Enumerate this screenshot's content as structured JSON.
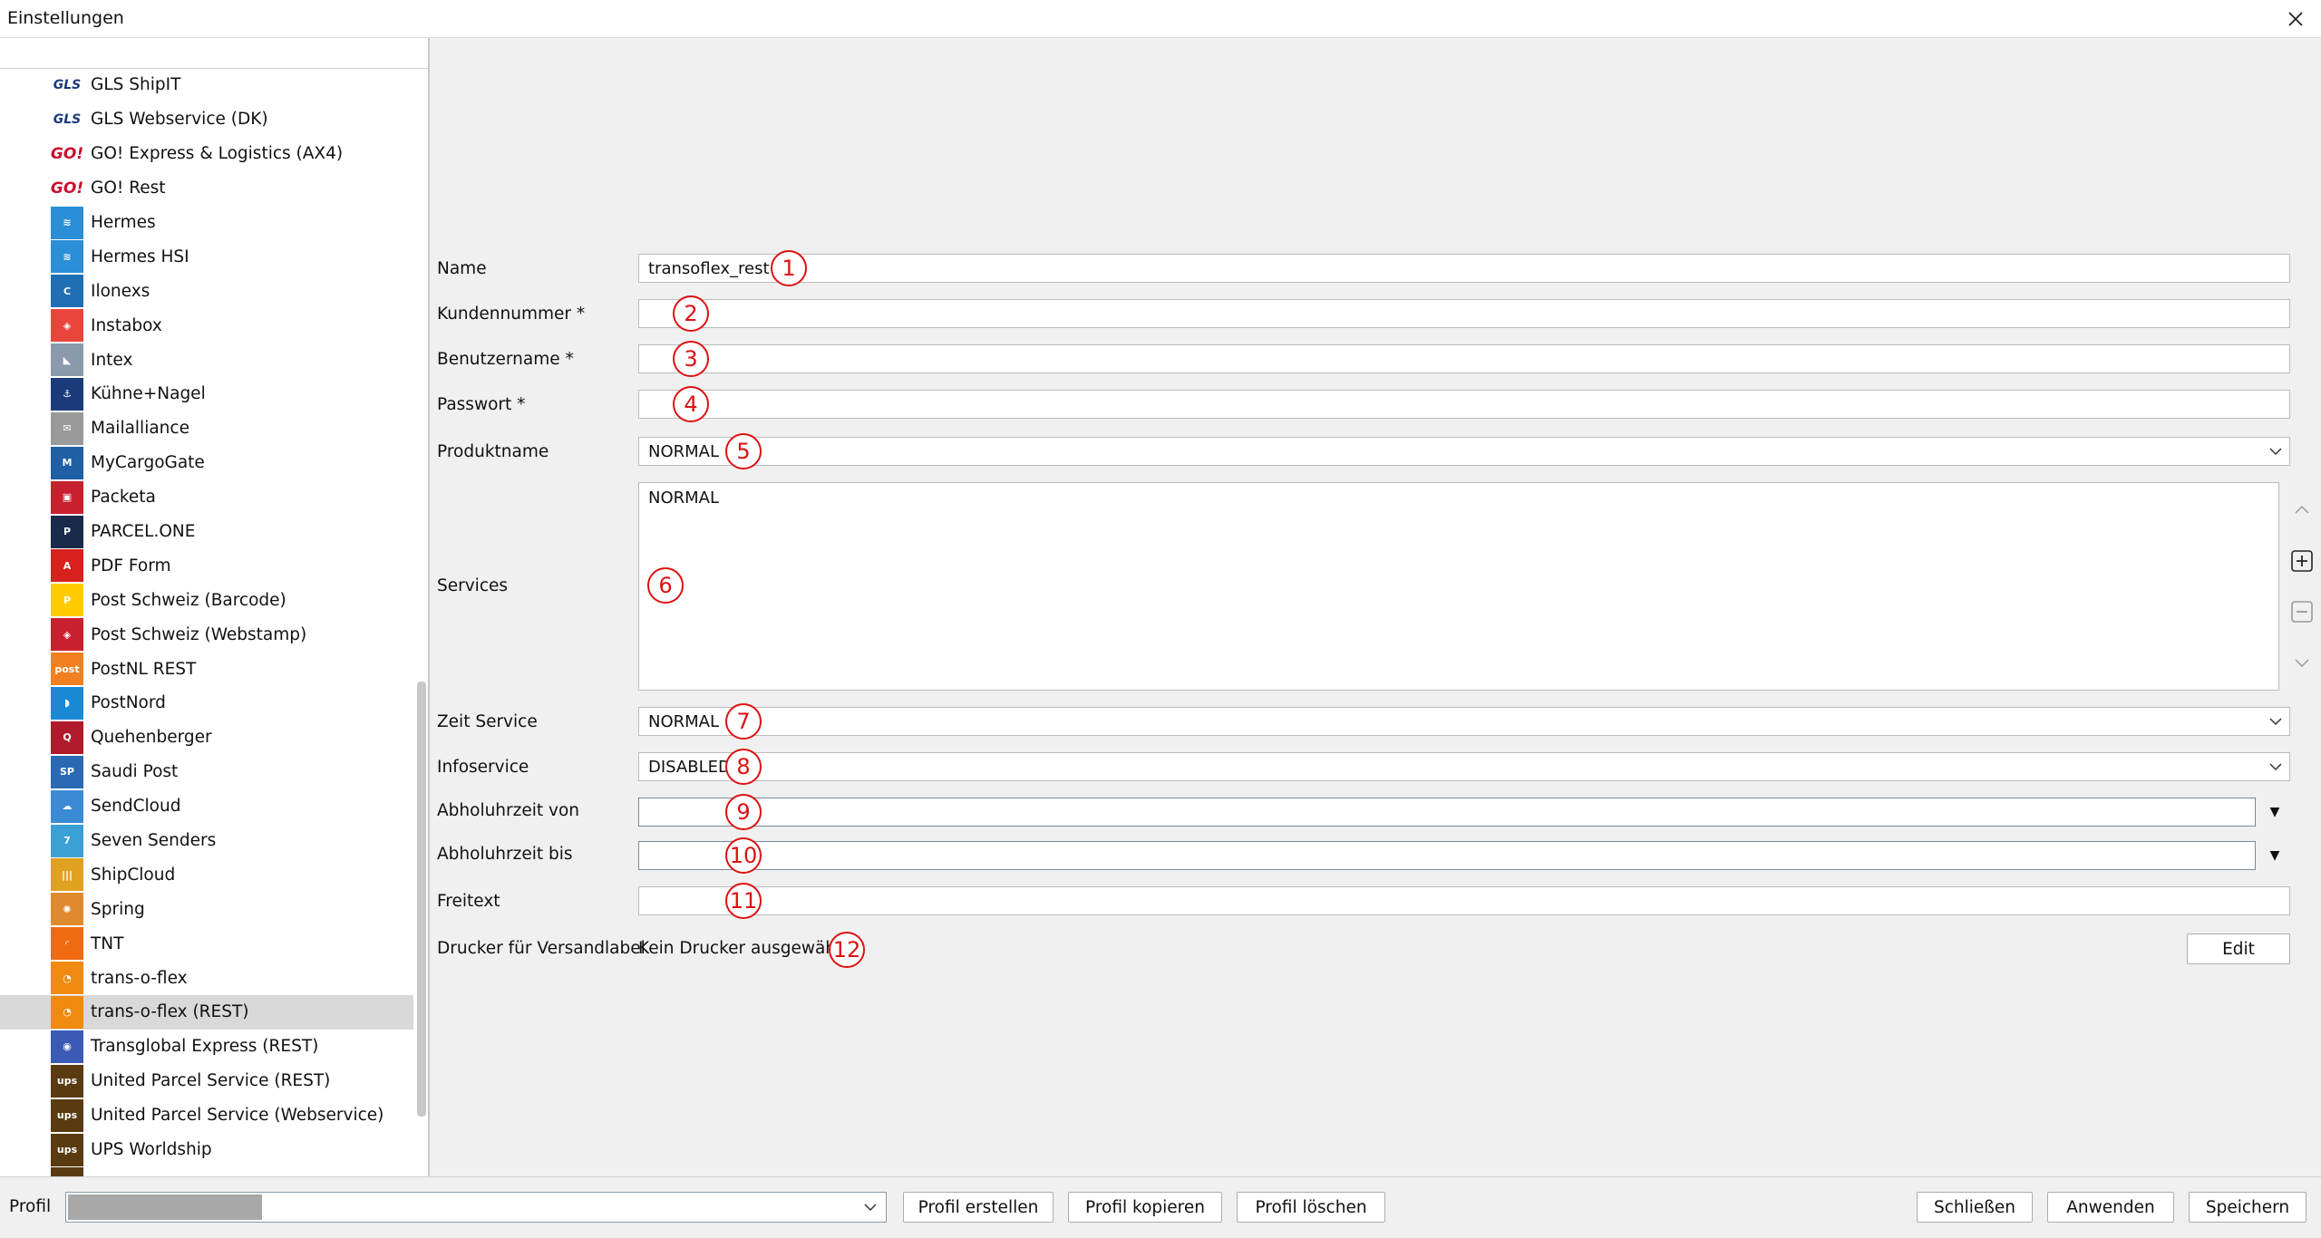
{
  "window": {
    "title": "Einstellungen"
  },
  "sidebar": {
    "items": [
      {
        "label": "GLS ShipIT",
        "icon": "gls-logo-icon",
        "icon_text": "GLS",
        "icon_style": "txt",
        "color": "#1a3a7a"
      },
      {
        "label": "GLS Webservice (DK)",
        "icon": "gls-logo-icon",
        "icon_text": "GLS",
        "icon_style": "txt",
        "color": "#1a3a7a"
      },
      {
        "label": "GO! Express & Logistics (AX4)",
        "icon": "go-logo-icon",
        "icon_text": "GO!",
        "icon_style": "go",
        "color": "#c8102e"
      },
      {
        "label": "GO! Rest",
        "icon": "go-logo-icon",
        "icon_text": "GO!",
        "icon_style": "go",
        "color": "#c8102e"
      },
      {
        "label": "Hermes",
        "icon": "hermes-logo-icon",
        "icon_text": "≋",
        "color": "#2a8fd6"
      },
      {
        "label": "Hermes HSI",
        "icon": "hermes-logo-icon",
        "icon_text": "≋",
        "color": "#2a8fd6"
      },
      {
        "label": "Ilonexs",
        "icon": "ilonexs-logo-icon",
        "icon_text": "C",
        "color": "#1f6fb5"
      },
      {
        "label": "Instabox",
        "icon": "instabox-logo-icon",
        "icon_text": "◈",
        "color": "#e8453c"
      },
      {
        "label": "Intex",
        "icon": "intex-logo-icon",
        "icon_text": "◣",
        "color": "#8a9aaa"
      },
      {
        "label": "Kühne+Nagel",
        "icon": "kuehne-nagel-logo-icon",
        "icon_text": "⚓",
        "color": "#1a3a7a"
      },
      {
        "label": "Mailalliance",
        "icon": "envelope-icon",
        "icon_text": "✉",
        "color": "#9a9a9a"
      },
      {
        "label": "MyCargoGate",
        "icon": "mycargogate-logo-icon",
        "icon_text": "M",
        "color": "#1f5fa5"
      },
      {
        "label": "Packeta",
        "icon": "packeta-logo-icon",
        "icon_text": "▣",
        "color": "#c8202e"
      },
      {
        "label": "PARCEL.ONE",
        "icon": "parcel-one-logo-icon",
        "icon_text": "P",
        "color": "#1a2a4a"
      },
      {
        "label": "PDF Form",
        "icon": "pdf-icon",
        "icon_text": "A",
        "color": "#d8201e"
      },
      {
        "label": "Post Schweiz (Barcode)",
        "icon": "post-schweiz-logo-icon",
        "icon_text": "P",
        "color": "#ffcc00"
      },
      {
        "label": "Post Schweiz (Webstamp)",
        "icon": "post-schweiz-webstamp-icon",
        "icon_text": "◈",
        "color": "#c8202e"
      },
      {
        "label": "PostNL REST",
        "icon": "postnl-logo-icon",
        "icon_text": "post",
        "color": "#f08020"
      },
      {
        "label": "PostNord",
        "icon": "postnord-logo-icon",
        "icon_text": "◗",
        "color": "#1a8ad6"
      },
      {
        "label": "Quehenberger",
        "icon": "quehenberger-logo-icon",
        "icon_text": "Q",
        "color": "#b01a2a"
      },
      {
        "label": "Saudi Post",
        "icon": "saudi-post-logo-icon",
        "icon_text": "SP",
        "color": "#2a6ab5"
      },
      {
        "label": "SendCloud",
        "icon": "sendcloud-logo-icon",
        "icon_text": "☁",
        "color": "#3a8ad6"
      },
      {
        "label": "Seven Senders",
        "icon": "seven-senders-logo-icon",
        "icon_text": "7",
        "color": "#3aa0d6"
      },
      {
        "label": "ShipCloud",
        "icon": "shipcloud-logo-icon",
        "icon_text": "|||",
        "color": "#e0a020"
      },
      {
        "label": "Spring",
        "icon": "spring-logo-icon",
        "icon_text": "✺",
        "color": "#e08a30"
      },
      {
        "label": "TNT",
        "icon": "tnt-logo-icon",
        "icon_text": "◜",
        "color": "#f06a10"
      },
      {
        "label": "trans-o-flex",
        "icon": "trans-o-flex-logo-icon",
        "icon_text": "◔",
        "color": "#f08a10"
      },
      {
        "label": "trans-o-flex (REST)",
        "icon": "trans-o-flex-logo-icon",
        "icon_text": "◔",
        "color": "#f08a10",
        "selected": true
      },
      {
        "label": "Transglobal Express (REST)",
        "icon": "transglobal-logo-icon",
        "icon_text": "◉",
        "color": "#3a5ab5"
      },
      {
        "label": "United Parcel Service (REST)",
        "icon": "ups-logo-icon",
        "icon_text": "ups",
        "color": "#5a3a10"
      },
      {
        "label": "United Parcel Service (Webservice)",
        "icon": "ups-logo-icon",
        "icon_text": "ups",
        "color": "#5a3a10"
      },
      {
        "label": "UPS Worldship",
        "icon": "ups-logo-icon",
        "icon_text": "ups",
        "color": "#5a3a10"
      },
      {
        "label": "",
        "icon": "ups-logo-icon",
        "icon_text": "ups",
        "color": "#5a3a10"
      }
    ]
  },
  "form": {
    "name": {
      "label": "Name",
      "value": "transoflex_rest",
      "marker": "1"
    },
    "kundennummer": {
      "label": "Kundennummer *",
      "value": "",
      "marker": "2"
    },
    "benutzername": {
      "label": "Benutzername *",
      "value": "",
      "marker": "3"
    },
    "passwort": {
      "label": "Passwort *",
      "value": "",
      "marker": "4"
    },
    "produktname": {
      "label": "Produktname",
      "value": "NORMAL",
      "marker": "5"
    },
    "services": {
      "label": "Services",
      "value": "NORMAL",
      "marker": "6"
    },
    "zeit_service": {
      "label": "Zeit Service",
      "value": "NORMAL",
      "marker": "7"
    },
    "infoservice": {
      "label": "Infoservice",
      "value": "DISABLED",
      "marker": "8"
    },
    "abholuhrzeit_von": {
      "label": "Abholuhrzeit von",
      "value": "",
      "marker": "9"
    },
    "abholuhrzeit_bis": {
      "label": "Abholuhrzeit bis",
      "value": "",
      "marker": "10"
    },
    "freitext": {
      "label": "Freitext",
      "value": "",
      "marker": "11"
    },
    "drucker": {
      "label": "Drucker für Versandlabel",
      "value": "Kein Drucker ausgewählt",
      "marker": "12",
      "edit_label": "Edit"
    }
  },
  "bottom": {
    "profil_label": "Profil",
    "profil_value": "",
    "buttons": {
      "create": "Profil erstellen",
      "copy": "Profil kopieren",
      "delete": "Profil löschen",
      "close": "Schließen",
      "apply": "Anwenden",
      "save": "Speichern"
    }
  },
  "colors": {
    "marker": "#dd1111",
    "selected_row": "#d9d9d9"
  }
}
